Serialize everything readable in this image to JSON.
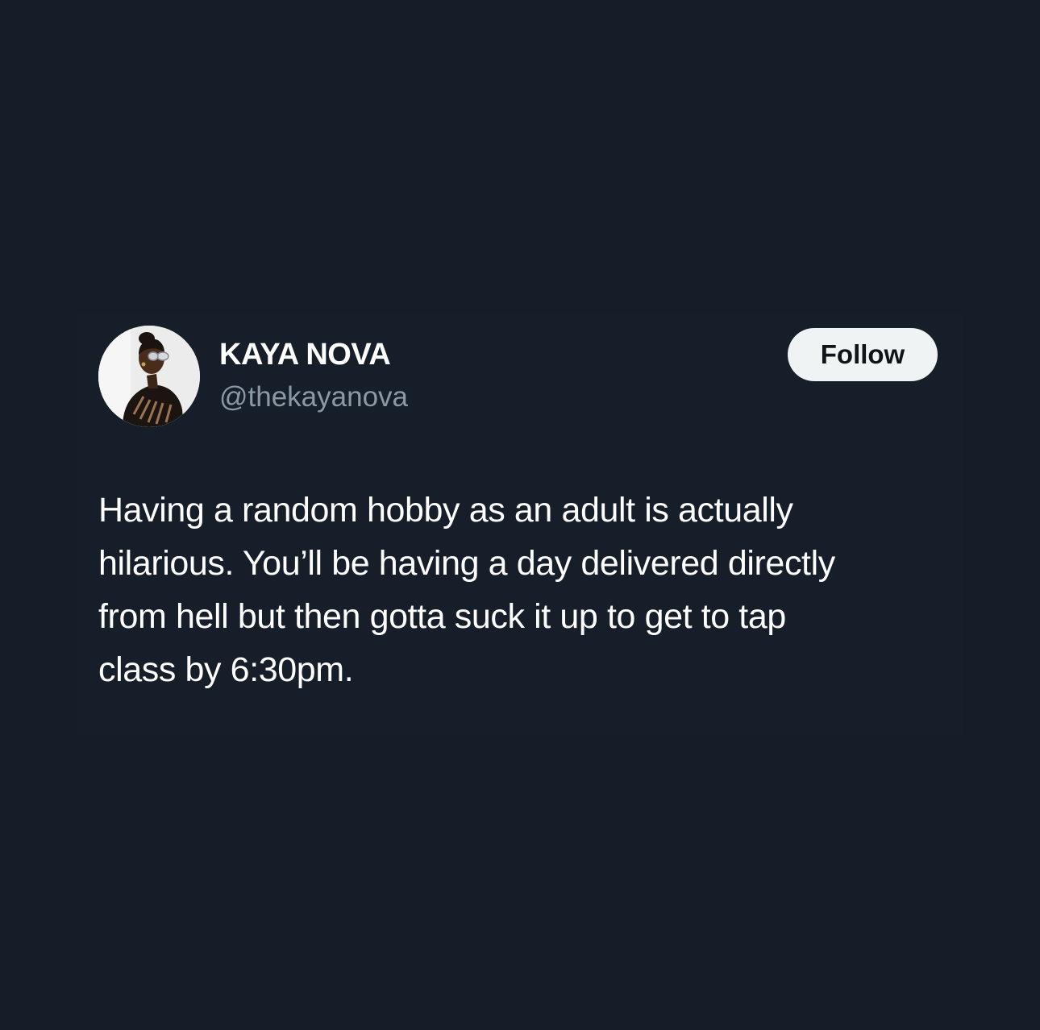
{
  "tweet": {
    "author": {
      "display_name": "KAYA NOVA",
      "handle": "@thekayanova",
      "avatar_icon": "profile-photo"
    },
    "follow_label": "Follow",
    "text_lines": [
      "Having a random hobby as an adult is actually",
      "hilarious. You’ll be having a day delivered directly",
      "from hell but then gotta suck it up to get to tap",
      "class by 6:30pm."
    ]
  },
  "colors": {
    "background": "#151d28",
    "text_primary": "#ffffff",
    "text_secondary": "#8b98a5",
    "button_bg": "#eff3f4",
    "button_text": "#0f1419"
  }
}
